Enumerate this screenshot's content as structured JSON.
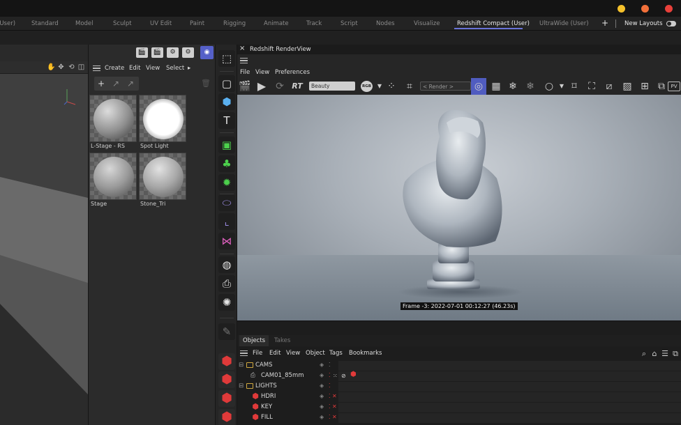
{
  "window_controls": {
    "colors": [
      "#f5c12b",
      "#f2703a",
      "#e8403a"
    ]
  },
  "layouts": {
    "tabs": [
      "(User)",
      "Standard",
      "Model",
      "Sculpt",
      "UV Edit",
      "Paint",
      "Rigging",
      "Animate",
      "Track",
      "Script",
      "Nodes",
      "Visualize",
      "Redshift Compact (User)",
      "UltraWide (User)"
    ],
    "active": "Redshift Compact (User)",
    "add_label": "+",
    "new_layouts_label": "New Layouts",
    "accent": "#6a73d8"
  },
  "material_manager": {
    "menu": [
      "Create",
      "Edit",
      "View",
      "Select"
    ],
    "more_glyph": "▸",
    "materials": [
      {
        "name": "L-Stage - RS"
      },
      {
        "name": "Spot Light"
      },
      {
        "name": "Stage"
      },
      {
        "name": "Stone_Tri"
      }
    ]
  },
  "render_view": {
    "title": "Redshift RenderView",
    "close_glyph": "×",
    "menu": [
      "File",
      "View",
      "Preferences"
    ],
    "rt_label": "RT",
    "aov_selected": "Beauty",
    "rgb_label": "RGB",
    "render_dropdown": "< Render >",
    "pv_label": "PV",
    "frame_info": "Frame -3:  2022-07-01  00:12:27  (46.23s)"
  },
  "objects_panel": {
    "tabs": [
      "Objects",
      "Takes"
    ],
    "active_tab": "Objects",
    "menu": [
      "File",
      "Edit",
      "View",
      "Object",
      "Tags",
      "Bookmarks"
    ],
    "rows": [
      {
        "name": "CAMS",
        "type": "folder",
        "expand": "⊟"
      },
      {
        "name": "CAM01_85mm",
        "type": "camera",
        "expand": ""
      },
      {
        "name": "LIGHTS",
        "type": "folder",
        "expand": "⊟"
      },
      {
        "name": "HDRI",
        "type": "light",
        "expand": ""
      },
      {
        "name": "KEY",
        "type": "light",
        "expand": ""
      },
      {
        "name": "FILL",
        "type": "light",
        "expand": ""
      }
    ]
  },
  "colors": {
    "accent_blue": "#505cc0",
    "redshift_red": "#e03a3a",
    "folder_yellow": "#d0a840"
  }
}
